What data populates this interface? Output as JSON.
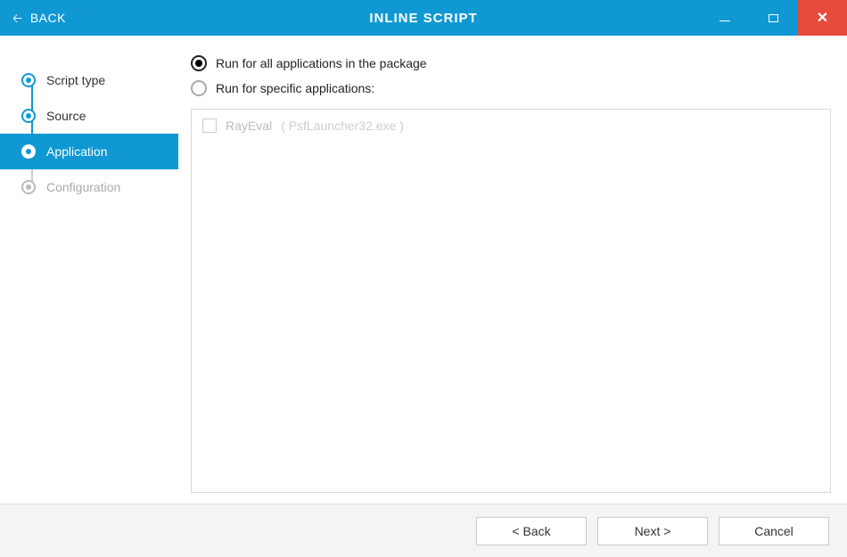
{
  "titlebar": {
    "back_label": "BACK",
    "title": "INLINE SCRIPT"
  },
  "sidebar": {
    "steps": [
      {
        "label": "Script type"
      },
      {
        "label": "Source"
      },
      {
        "label": "Application"
      },
      {
        "label": "Configuration"
      }
    ]
  },
  "main": {
    "radio_all_label": "Run for all applications in the package",
    "radio_specific_label": "Run for specific applications:",
    "apps": [
      {
        "name": "RayEval",
        "exe": "( PsfLauncher32.exe )"
      }
    ]
  },
  "footer": {
    "back_label": "< Back",
    "next_label": "Next >",
    "cancel_label": "Cancel"
  }
}
